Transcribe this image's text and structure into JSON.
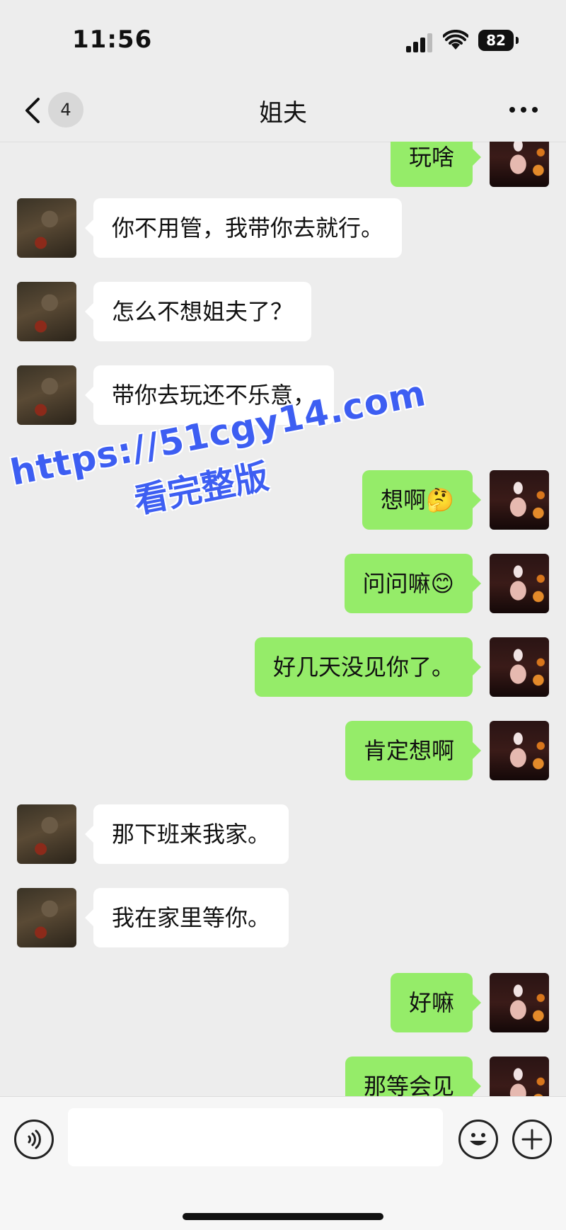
{
  "status_bar": {
    "time": "11:56",
    "battery": "82"
  },
  "nav": {
    "unread_count": "4",
    "title": "姐夫"
  },
  "messages": [
    {
      "side": "out",
      "text": "玩啥"
    },
    {
      "side": "in",
      "text": "你不用管，我带你去就行。"
    },
    {
      "side": "in",
      "text": "怎么不想姐夫了？"
    },
    {
      "side": "in",
      "text": "带你去玩还不乐意，"
    },
    {
      "side": "out",
      "text": "想啊🤔"
    },
    {
      "side": "out",
      "text": "问问嘛😊"
    },
    {
      "side": "out",
      "text": "好几天没见你了。"
    },
    {
      "side": "out",
      "text": "肯定想啊"
    },
    {
      "side": "in",
      "text": "那下班来我家。"
    },
    {
      "side": "in",
      "text": "我在家里等你。"
    },
    {
      "side": "out",
      "text": "好嘛"
    },
    {
      "side": "out",
      "text": "那等会见"
    }
  ],
  "watermark": {
    "url": "https://51cgy14.com",
    "subtitle": "看完整版"
  },
  "input": {
    "value": ""
  },
  "colors": {
    "outgoing_bubble": "#95ec69",
    "incoming_bubble": "#ffffff",
    "background": "#ededed"
  }
}
